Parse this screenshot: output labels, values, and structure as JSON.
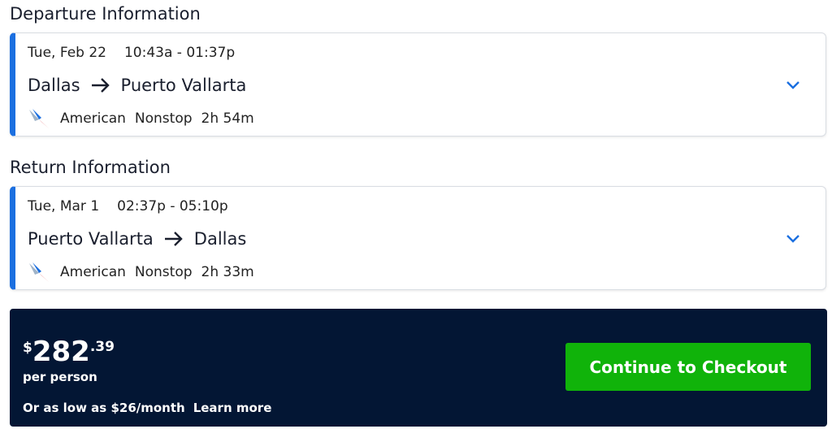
{
  "departure": {
    "section_title": "Departure Information",
    "date": "Tue, Feb 22",
    "time": "10:43a - 01:37p",
    "origin": "Dallas",
    "destination": "Puerto Vallarta",
    "airline": "American",
    "stops": "Nonstop",
    "duration": "2h 54m"
  },
  "return": {
    "section_title": "Return Information",
    "date": "Tue, Mar 1",
    "time": "02:37p - 05:10p",
    "origin": "Puerto Vallarta",
    "destination": "Dallas",
    "airline": "American",
    "stops": "Nonstop",
    "duration": "2h 33m"
  },
  "price": {
    "currency": "$",
    "dollars": "282",
    "cents": ".39",
    "per_person": "per person",
    "financing": "Or as low as $26/month",
    "learn_more": "Learn more"
  },
  "checkout_button": "Continue to Checkout",
  "icons": {
    "route_arrow": "arrow-right-icon",
    "expand": "chevron-down-icon",
    "airline_logo": "american-airlines-logo"
  },
  "colors": {
    "accent_blue": "#1b6fe0",
    "panel_navy": "#031634",
    "checkout_green": "#10b30a"
  }
}
